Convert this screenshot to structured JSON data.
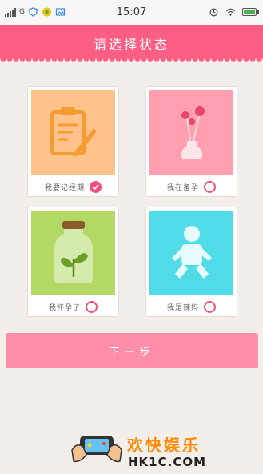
{
  "status_bar": {
    "time": "15:07",
    "network": "G",
    "battery_percent": 100
  },
  "header": {
    "title": "请选择状态"
  },
  "options": [
    {
      "label": "我要记经期",
      "icon": "clipboard-pencil-icon",
      "color": "#ffc28a",
      "selected": true
    },
    {
      "label": "我在备孕",
      "icon": "flower-vase-icon",
      "color": "#ff9fb0",
      "selected": false
    },
    {
      "label": "我怀孕了",
      "icon": "sprout-jar-icon",
      "color": "#b3d964",
      "selected": false
    },
    {
      "label": "我是辣妈",
      "icon": "baby-icon",
      "color": "#4fdbe8",
      "selected": false
    }
  ],
  "next_button": {
    "label": "下一步"
  },
  "watermark": {
    "title": "欢快娱乐",
    "url": "HK1C.COM"
  },
  "colors": {
    "accent": "#fd5f84",
    "button": "#fe8ea9",
    "background": "#f3eee9"
  }
}
